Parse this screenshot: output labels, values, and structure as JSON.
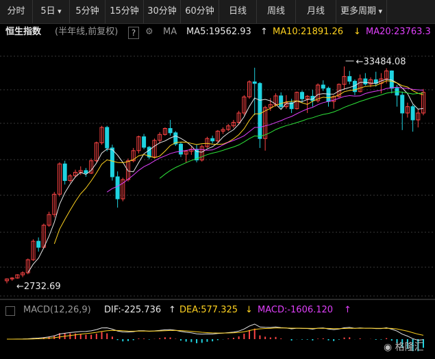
{
  "tabs": [
    {
      "label": "分时",
      "dropdown": false
    },
    {
      "label": "5日",
      "dropdown": true
    },
    {
      "label": "5分钟",
      "dropdown": false
    },
    {
      "label": "15分钟",
      "dropdown": false
    },
    {
      "label": "30分钟",
      "dropdown": false
    },
    {
      "label": "60分钟",
      "dropdown": false
    },
    {
      "label": "日线",
      "dropdown": false
    },
    {
      "label": "周线",
      "dropdown": false
    },
    {
      "label": "月线",
      "dropdown": false
    },
    {
      "label": "更多周期",
      "dropdown": true
    }
  ],
  "info": {
    "index_name": "恒生指数",
    "mode": "(半年线,前复权)",
    "help": "?",
    "ma_label": "MA",
    "ma5": "MA5:19562.93",
    "ma5_arrow": "↑",
    "ma10": "MA10:21891.26",
    "ma10_arrow": "↓",
    "ma20": "MA20:23763.3"
  },
  "annotations": {
    "high": "33484.08",
    "low": "2732.69"
  },
  "macd": {
    "label": "MACD(12,26,9)",
    "dif": "DIF:-225.736",
    "dif_arrow": "↑",
    "dea": "DEA:577.325",
    "dea_arrow": "↓",
    "macd": "MACD:-1606.120",
    "macd_arrow": "↑"
  },
  "colors": {
    "up": "#ff4444",
    "down": "#1fd3e0",
    "ma5": "#e8e8e8",
    "ma10": "#ffd21f",
    "ma20": "#e040fb",
    "ma_long": "#2ee63a"
  },
  "watermark": "格隆汇",
  "chart_data": {
    "type": "candlestick",
    "series_names": [
      "MA5",
      "MA10",
      "MA20"
    ],
    "x": "half-year periods (unlabelled)",
    "ohlc": [
      [
        2780,
        2860,
        2700,
        2840
      ],
      [
        2840,
        2900,
        2780,
        2870
      ],
      [
        2870,
        3000,
        2850,
        2980
      ],
      [
        2980,
        3100,
        2900,
        3050
      ],
      [
        3050,
        3600,
        3000,
        3550
      ],
      [
        3550,
        4500,
        3500,
        4400
      ],
      [
        4400,
        4600,
        3900,
        4100
      ],
      [
        4100,
        5400,
        4050,
        5300
      ],
      [
        5300,
        6200,
        5200,
        6000
      ],
      [
        6000,
        7800,
        5800,
        7600
      ],
      [
        7600,
        11000,
        7400,
        10800
      ],
      [
        10800,
        11200,
        8500,
        8900
      ],
      [
        8900,
        9600,
        8700,
        9400
      ],
      [
        9400,
        10100,
        9200,
        9800
      ],
      [
        9800,
        10500,
        9500,
        10000
      ],
      [
        10000,
        10300,
        9300,
        9700
      ],
      [
        9700,
        11500,
        9600,
        11200
      ],
      [
        11200,
        14000,
        11000,
        13800
      ],
      [
        13800,
        16800,
        13500,
        16500
      ],
      [
        16500,
        16800,
        12500,
        13000
      ],
      [
        13000,
        13500,
        8900,
        9300
      ],
      [
        9300,
        9900,
        6500,
        7200
      ],
      [
        7200,
        9200,
        7000,
        9000
      ],
      [
        9000,
        11500,
        8800,
        11200
      ],
      [
        11200,
        13000,
        11000,
        12600
      ],
      [
        12600,
        15000,
        12200,
        14800
      ],
      [
        14800,
        15300,
        12800,
        13100
      ],
      [
        13100,
        13300,
        11400,
        11700
      ],
      [
        11700,
        14500,
        11500,
        14200
      ],
      [
        14200,
        15600,
        13700,
        15200
      ],
      [
        15200,
        16500,
        15000,
        16300
      ],
      [
        16300,
        18000,
        15000,
        15500
      ],
      [
        15500,
        15800,
        13300,
        13600
      ],
      [
        13600,
        13900,
        11700,
        12100
      ],
      [
        12100,
        12700,
        11000,
        12500
      ],
      [
        12500,
        13200,
        12000,
        12800
      ],
      [
        12800,
        13500,
        11000,
        11300
      ],
      [
        11300,
        13500,
        11100,
        13200
      ],
      [
        13200,
        14800,
        13000,
        14500
      ],
      [
        14500,
        15000,
        13700,
        14100
      ],
      [
        14100,
        16000,
        13900,
        15800
      ],
      [
        15800,
        16500,
        15300,
        16100
      ],
      [
        16100,
        17200,
        15800,
        16800
      ],
      [
        16800,
        18000,
        16400,
        17500
      ],
      [
        17500,
        20000,
        17000,
        19500
      ],
      [
        19500,
        24000,
        19000,
        23500
      ],
      [
        23500,
        28500,
        23000,
        28000
      ],
      [
        28000,
        33000,
        19000,
        27500
      ],
      [
        27500,
        27900,
        13000,
        14500
      ],
      [
        14500,
        21200,
        12600,
        20800
      ],
      [
        20800,
        23200,
        20000,
        21500
      ],
      [
        21500,
        24500,
        21000,
        23800
      ],
      [
        23800,
        24800,
        20500,
        21000
      ],
      [
        21000,
        24000,
        20500,
        22000
      ],
      [
        22000,
        23000,
        19500,
        20500
      ],
      [
        20500,
        25000,
        20300,
        24800
      ],
      [
        24800,
        25300,
        22000,
        23000
      ],
      [
        23000,
        24000,
        19500,
        23700
      ],
      [
        23700,
        25500,
        21000,
        22500
      ],
      [
        22500,
        27500,
        22000,
        27000
      ],
      [
        27000,
        28500,
        25200,
        26000
      ],
      [
        26000,
        26500,
        21000,
        22300
      ],
      [
        22300,
        24000,
        20500,
        23600
      ],
      [
        23600,
        27500,
        23300,
        27200
      ],
      [
        27200,
        33484,
        25500,
        29800
      ],
      [
        29800,
        31800,
        27200,
        28200
      ],
      [
        28200,
        28800,
        24000,
        25000
      ],
      [
        25000,
        30500,
        24800,
        29000
      ],
      [
        29000,
        31000,
        26800,
        27300
      ],
      [
        27300,
        29500,
        26300,
        28700
      ],
      [
        28700,
        31500,
        26500,
        27500
      ],
      [
        27500,
        31000,
        24500,
        29000
      ],
      [
        29000,
        32800,
        27500,
        31800
      ],
      [
        31800,
        32000,
        24500,
        26000
      ],
      [
        26000,
        27000,
        21000,
        24000
      ],
      [
        24000,
        25000,
        16000,
        19500
      ],
      [
        19500,
        22000,
        18500,
        21000
      ],
      [
        21000,
        21500,
        15700,
        18000
      ],
      [
        18000,
        20500,
        16500,
        19500
      ],
      [
        19500,
        25800,
        19000,
        24800
      ]
    ]
  }
}
